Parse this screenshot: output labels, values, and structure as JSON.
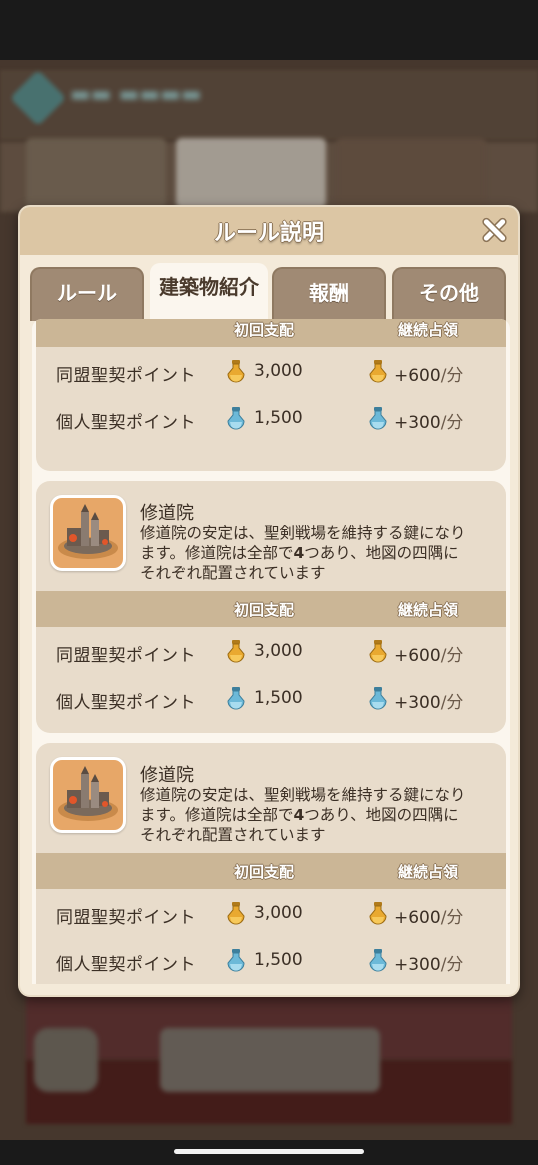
{
  "modal": {
    "title": "ルール説明",
    "close": "close"
  },
  "tabs": [
    {
      "label": "ルール",
      "active": false
    },
    {
      "label": "建築物紹介",
      "active": true
    },
    {
      "label": "報酬",
      "active": false
    },
    {
      "label": "その他",
      "active": false
    }
  ],
  "table_headers": {
    "first": "初回支配",
    "continuous": "継続占領"
  },
  "sections": [
    {
      "rows": [
        {
          "label": "同盟聖契ポイント",
          "first": "3,000",
          "cont_value": "+600",
          "cont_unit": "/分",
          "icon": "gold-potion-icon"
        },
        {
          "label": "個人聖契ポイント",
          "first": "1,500",
          "cont_value": "+300",
          "cont_unit": "/分",
          "icon": "blue-potion-icon"
        }
      ]
    },
    {
      "name": "修道院",
      "desc1": "修道院の安定は、聖剣戦場を維持する鍵になり",
      "desc2": "ます。修道院は全部で",
      "desc2_bold": "4",
      "desc2_rest": "つあり、地図の四隅に",
      "desc3": "それぞれ配置されています",
      "rows": [
        {
          "label": "同盟聖契ポイント",
          "first": "3,000",
          "cont_value": "+600",
          "cont_unit": "/分",
          "icon": "gold-potion-icon"
        },
        {
          "label": "個人聖契ポイント",
          "first": "1,500",
          "cont_value": "+300",
          "cont_unit": "/分",
          "icon": "blue-potion-icon"
        }
      ]
    },
    {
      "name": "修道院",
      "desc1": "修道院の安定は、聖剣戦場を維持する鍵になり",
      "desc2": "ます。修道院は全部で",
      "desc2_bold": "4",
      "desc2_rest": "つあり、地図の四隅に",
      "desc3": "それぞれ配置されています",
      "rows": [
        {
          "label": "同盟聖契ポイント",
          "first": "3,000",
          "cont_value": "+600",
          "cont_unit": "/分",
          "icon": "gold-potion-icon"
        },
        {
          "label": "個人聖契ポイント",
          "first": "1,500",
          "cont_value": "+300",
          "cont_unit": "/分",
          "icon": "blue-potion-icon"
        }
      ]
    }
  ],
  "colors": {
    "header": "#dcc6a4",
    "panel": "#f4ead9",
    "section": "#e8dccb",
    "table_head": "#cbb696",
    "tab_inactive": "#a08a74",
    "gold_potion": "#e9a930",
    "blue_potion": "#6cb9d8"
  }
}
